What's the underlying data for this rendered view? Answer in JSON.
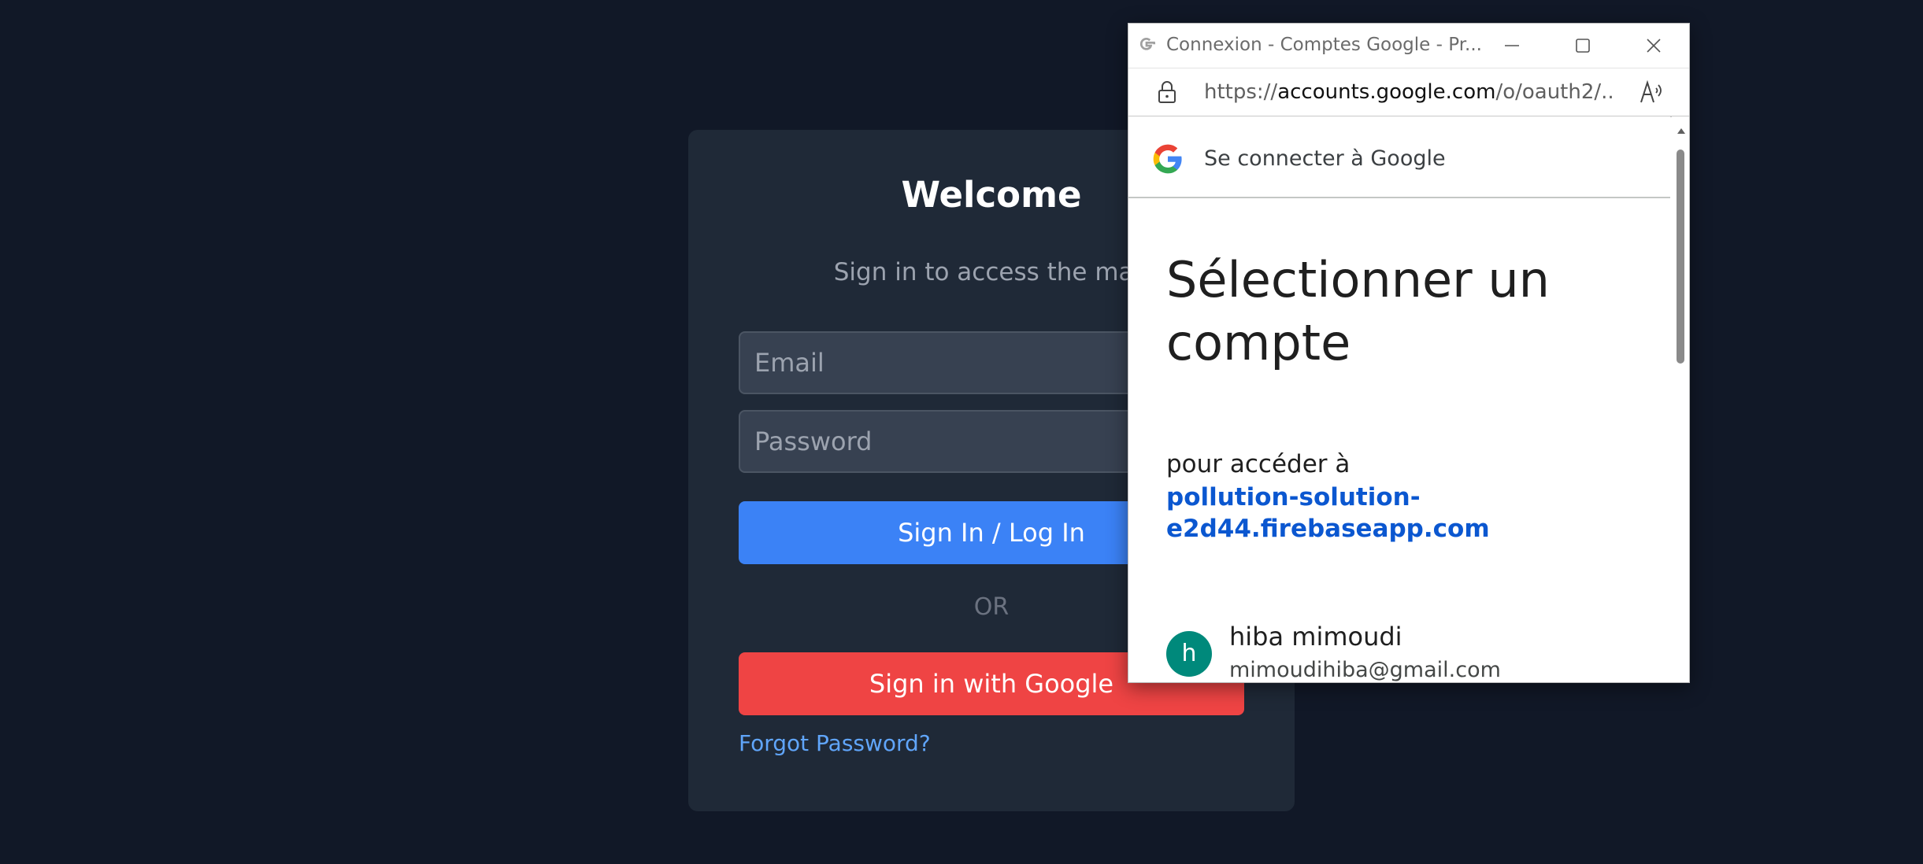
{
  "login": {
    "title": "Welcome",
    "subtitle": "Sign in to access the map",
    "email_placeholder": "Email",
    "password_placeholder": "Password",
    "signin_label": "Sign In / Log In",
    "or_label": "OR",
    "google_label": "Sign in with Google",
    "forgot_label": "Forgot Password?"
  },
  "popup": {
    "window_title": "Connexion - Comptes Google - Pr...",
    "url_prefix": "https://",
    "url_host": "accounts.google.com",
    "url_path": "/o/oauth2/...",
    "header_text": "Se connecter à Google",
    "heading": "Sélectionner un compte",
    "subheading": "pour accéder à",
    "app_domain": "pollution-solution-e2d44.firebaseapp.com",
    "account": {
      "avatar_letter": "h",
      "name": "hiba mimoudi",
      "email": "mimoudihiba@gmail.com"
    }
  },
  "icons": {
    "titlebar_favicon": "google-g-icon",
    "minimize": "minimize-icon",
    "maximize": "maximize-icon",
    "close": "close-icon",
    "lock": "lock-icon",
    "read_aloud": "read-aloud-icon",
    "google_logo": "google-logo-icon"
  },
  "colors": {
    "page_bg": "#111827",
    "card_bg": "#1f2937",
    "signin_button": "#3b82f6",
    "google_button": "#ef4444",
    "link": "#60a5fa",
    "google_blue": "#0b57d0",
    "avatar": "#00897b"
  }
}
